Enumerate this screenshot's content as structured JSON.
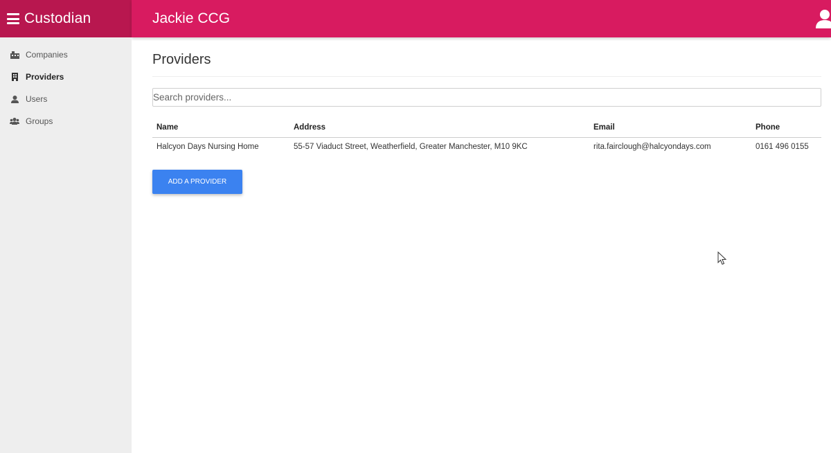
{
  "header": {
    "app_name": "Custodian",
    "org_name": "Jackie CCG",
    "menu_icon": "hamburger-menu-icon",
    "user_icon": "user-account-icon"
  },
  "sidebar": {
    "items": [
      {
        "label": "Companies",
        "icon": "building-icon",
        "active": false
      },
      {
        "label": "Providers",
        "icon": "office-building-icon",
        "active": true
      },
      {
        "label": "Users",
        "icon": "user-icon",
        "active": false
      },
      {
        "label": "Groups",
        "icon": "users-group-icon",
        "active": false
      }
    ]
  },
  "main": {
    "title": "Providers",
    "search": {
      "placeholder": "Search providers...",
      "value": ""
    },
    "table": {
      "headers": [
        "Name",
        "Address",
        "Email",
        "Phone"
      ],
      "rows": [
        [
          "Halcyon Days Nursing Home",
          "55-57 Viaduct Street, Weatherfield, Greater Manchester, M10 9KC",
          "rita.fairclough@halcyondays.com",
          "0161 496 0155"
        ]
      ]
    },
    "add_button": "ADD A PROVIDER"
  },
  "colors": {
    "brand": "#b8174f",
    "topbar": "#d81b60",
    "sidebar_bg": "#eeeeee",
    "button": "#3b82f0"
  }
}
